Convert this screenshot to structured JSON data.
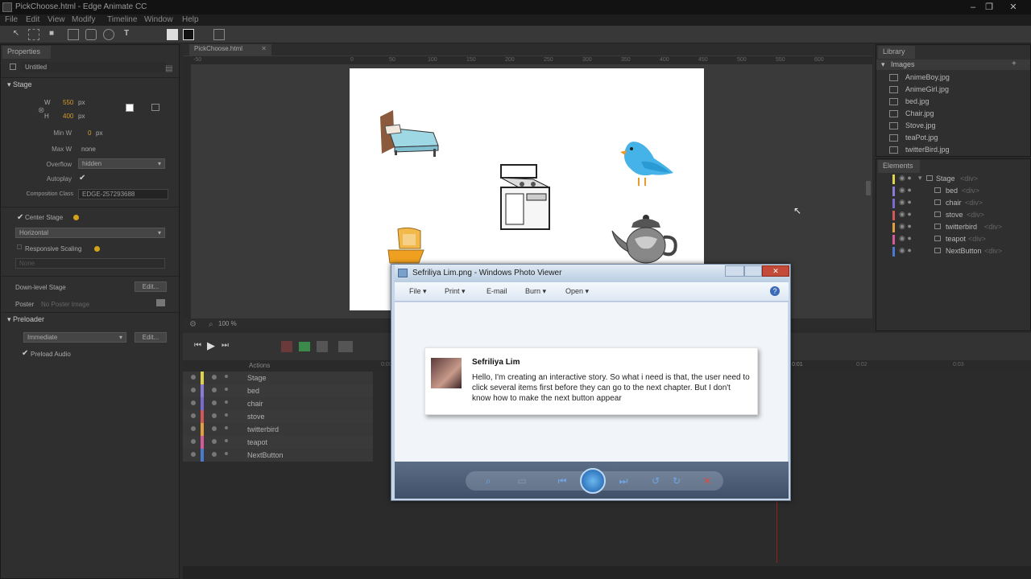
{
  "window": {
    "title": "PickChoose.html - Edge Animate CC"
  },
  "menu": [
    "File",
    "Edit",
    "View",
    "Modify",
    "Timeline",
    "Window",
    "Help"
  ],
  "properties": {
    "tab": "Properties",
    "element_name": "Untitled",
    "stage_section": "Stage",
    "w_label": "W",
    "w_value": "550",
    "h_label": "H",
    "h_value": "400",
    "unit": "px",
    "min_w_label": "Min W",
    "min_w_value": "0",
    "max_w_label": "Max W",
    "max_w_value": "none",
    "overflow_label": "Overflow",
    "overflow_value": "hidden",
    "autoplay_label": "Autoplay",
    "composition_class_label": "Composition Class",
    "composition_class_value": "EDGE-257293688",
    "center_stage_label": "Center Stage",
    "center_stage_value": "Horizontal",
    "responsive_scaling_label": "Responsive Scaling",
    "responsive_value": "None",
    "down_level_stage_label": "Down-level Stage",
    "edit_label": "Edit...",
    "poster_label": "Poster",
    "poster_value": "No Poster Image",
    "preloader_label": "Preloader",
    "preloader_value": "Immediate",
    "preload_audio_label": "Preload Audio"
  },
  "document_tab": "PickChoose.html",
  "ruler_marks": [
    "-50",
    "0",
    "50",
    "100",
    "150",
    "200",
    "250",
    "300",
    "350",
    "400",
    "450",
    "500",
    "550",
    "600",
    "650",
    "700",
    "750"
  ],
  "zoom": "100 %",
  "library": {
    "tab": "Library",
    "section": "Images",
    "items": [
      "AnimeBoy.jpg",
      "AnimeGirl.jpg",
      "bed.jpg",
      "Chair.jpg",
      "Stove.jpg",
      "teaPot.jpg",
      "twitterBird.jpg"
    ]
  },
  "elements": {
    "tab": "Elements",
    "rows": [
      {
        "name": "Stage",
        "tag": "<div>"
      },
      {
        "name": "bed",
        "tag": "<div>"
      },
      {
        "name": "chair",
        "tag": "<div>"
      },
      {
        "name": "stove",
        "tag": "<div>"
      },
      {
        "name": "twitterbird",
        "tag": "<div>"
      },
      {
        "name": "teapot",
        "tag": "<div>"
      },
      {
        "name": "NextButton",
        "tag": "<div>"
      }
    ]
  },
  "timeline": {
    "actions_label": "Actions",
    "layers": [
      "Stage",
      "bed",
      "chair",
      "stove",
      "twitterbird",
      "teapot",
      "NextButton"
    ],
    "layer_colors": [
      "#e0d24a",
      "#8b7ad6",
      "#7a6ad0",
      "#d4585a",
      "#e0a040",
      "#d45a9a",
      "#4a7ad0"
    ],
    "time_marks": [
      "0:00",
      "0:01",
      "0:02",
      "0:03",
      "0:04"
    ]
  },
  "viewer": {
    "title": "Sefriliya Lim.png - Windows Photo Viewer",
    "menu": [
      "File",
      "Print",
      "E-mail",
      "Burn",
      "Open"
    ],
    "card_name": "Sefriliya Lim",
    "card_message": "Hello, I'm creating an interactive story. So what i need is that, the user need to click several items first before they can go to the next chapter. But I don't know how to make the next button appear"
  }
}
